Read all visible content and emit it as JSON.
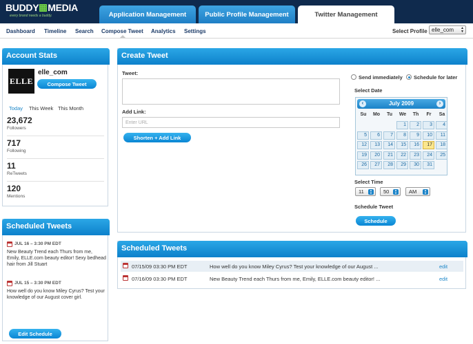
{
  "brand": {
    "name_left": "BUDDY",
    "name_right": "MEDIA",
    "tagline": "every brand needs a buddy."
  },
  "tabs": [
    "Application Management",
    "Public Profile Management",
    "Twitter Management"
  ],
  "subnav": {
    "items": [
      "Dashboard",
      "Timeline",
      "Search",
      "Compose Tweet",
      "Analytics",
      "Settings"
    ],
    "profile_label": "Select Profile",
    "profile_value": "elle_com"
  },
  "account_stats": {
    "title": "Account Stats",
    "avatar_text": "ELLE",
    "username": "elle_com",
    "compose_label": "Compose Tweet",
    "periods": [
      "Today",
      "This Week",
      "This Month"
    ],
    "stats": [
      {
        "value": "23,672",
        "label": "Followers"
      },
      {
        "value": "717",
        "label": "Following"
      },
      {
        "value": "11",
        "label": "ReTweets"
      },
      {
        "value": "120",
        "label": "Mentions"
      }
    ]
  },
  "side_schedule": {
    "title": "Scheduled Tweets",
    "items": [
      {
        "date": "JUL 16 – 3:30 PM EDT",
        "text": "New Beauty Trend each Thurs from me, Emily, ELLE.com beauty editor! Sexy bedhead hair from Jill Stuart"
      },
      {
        "date": "JUL 15 – 3:30 PM EDT",
        "text": "How well do you know Miley Cyrus? Test your knowledge of our August cover girl."
      }
    ],
    "edit_label": "Edit Schedule"
  },
  "create_tweet": {
    "title": "Create Tweet",
    "tweet_label": "Tweet:",
    "link_label": "Add Link:",
    "url_placeholder": "Enter URL",
    "shorten_label": "Shorten + Add Link",
    "send_now_label": "Send immediately",
    "schedule_later_label": "Schedule for later",
    "select_date_label": "Select Date",
    "calendar": {
      "month_title": "July 2009",
      "weekdays": [
        "Su",
        "Mo",
        "Tu",
        "We",
        "Th",
        "Fr",
        "Sa"
      ],
      "first_weekday": 3,
      "days_in_month": 31,
      "selected_day": 17
    },
    "select_time_label": "Select Time",
    "time": {
      "hour": "11",
      "minute": "50",
      "ampm": "AM"
    },
    "schedule_tweet_label": "Schedule Tweet",
    "schedule_button": "Schedule"
  },
  "scheduled_main": {
    "title": "Scheduled Tweets",
    "rows": [
      {
        "date": "07/15/09 03:30 PM EDT",
        "text": "How well do you know Miley Cyrus? Test your knowledge of our August ...",
        "edit": "edit"
      },
      {
        "date": "07/16/09 03:30 PM EDT",
        "text": "New Beauty Trend each Thurs from me, Emily, ELLE.com beauty editor! ...",
        "edit": "edit"
      }
    ]
  },
  "colors": {
    "header_bg": "#0f2a4d",
    "accent": "#1b86c8",
    "today_highlight": "#fbe78d"
  }
}
